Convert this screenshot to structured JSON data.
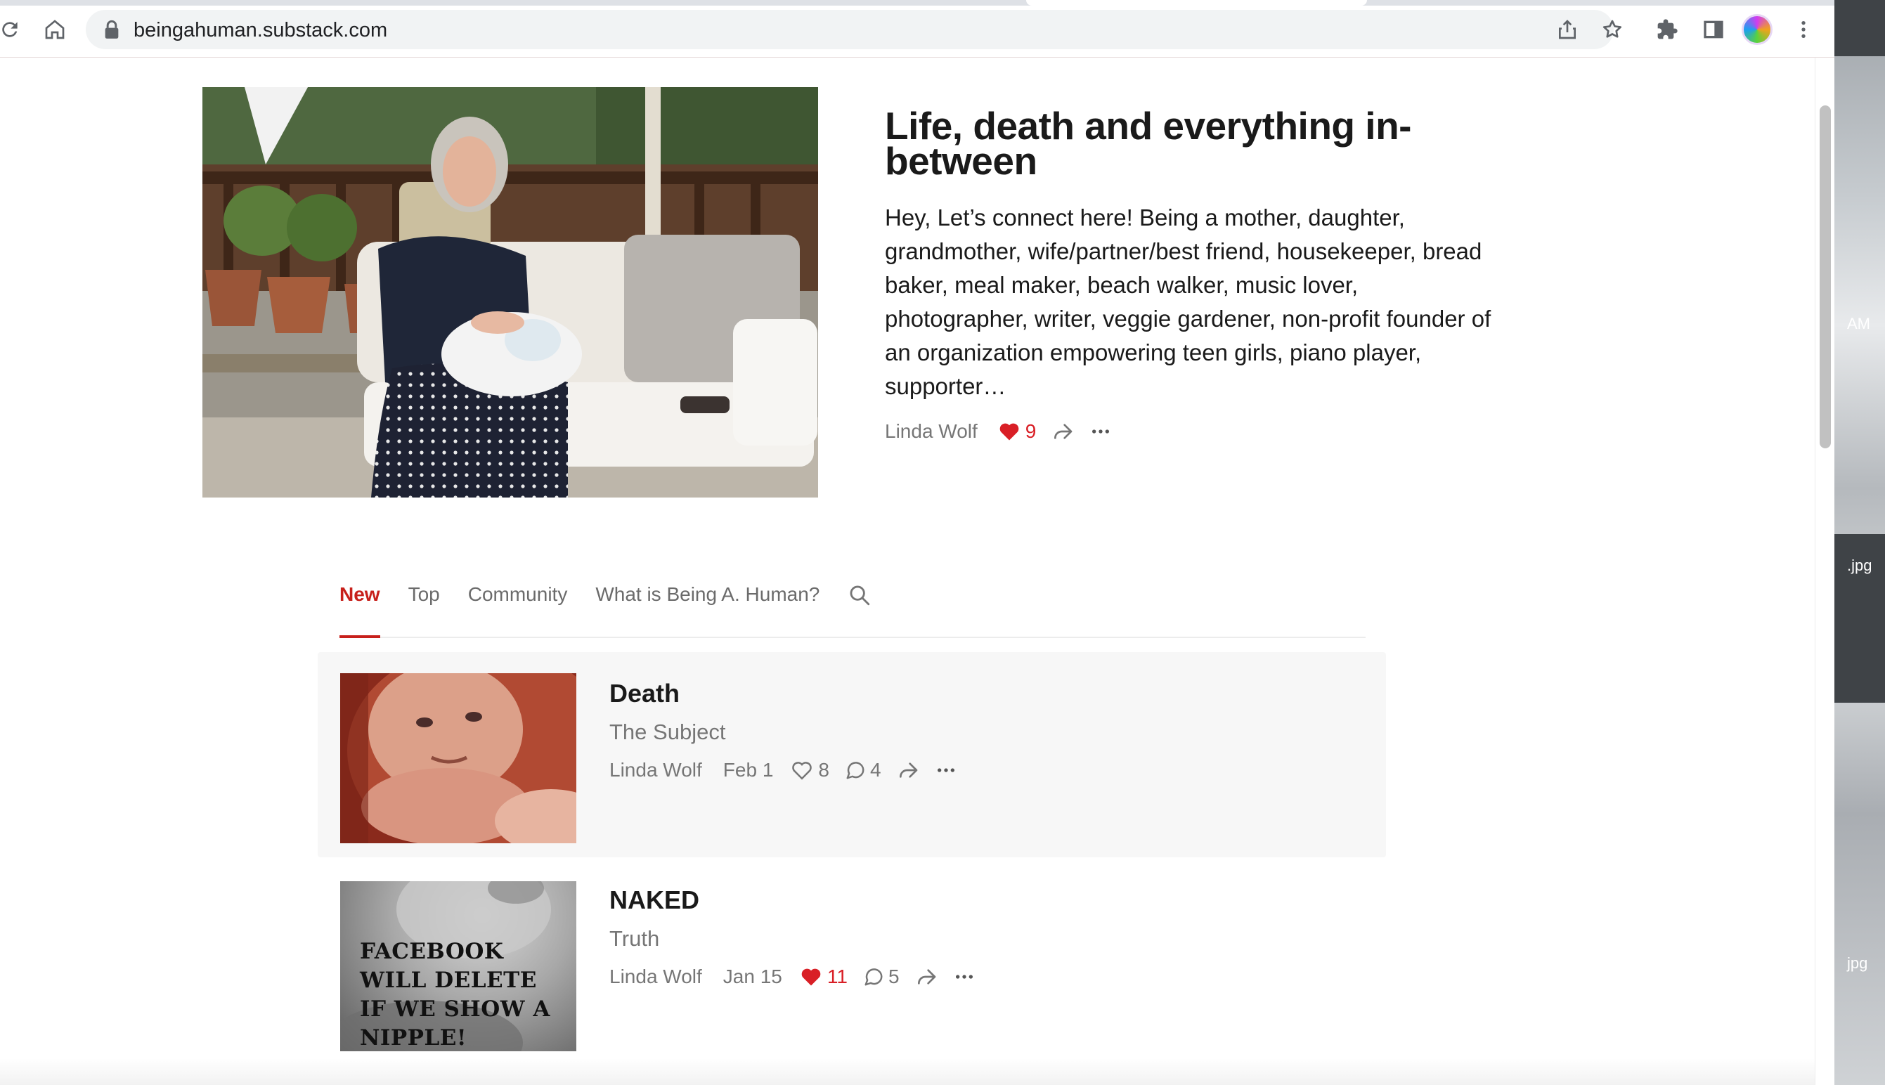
{
  "browser": {
    "url": "beingahuman.substack.com",
    "icons": [
      "reload-icon",
      "home-icon",
      "lock-icon",
      "share-icon",
      "star-icon",
      "extensions-icon",
      "side-panel-icon",
      "profile-avatar",
      "kebab-menu-icon"
    ]
  },
  "desktop": {
    "labels": [
      "AM",
      ".jpg",
      "jpg"
    ]
  },
  "hero": {
    "title": "Life, death and everything in-between",
    "subtitle": "Hey, Let’s connect here! Being a mother, daughter, grandmother, wife/partner/best friend, housekeeper, bread baker, meal maker, beach walker, music lover, photographer, writer, veggie gardener, non-profit founder of an organization empowering teen girls, piano player, supporter…",
    "author": "Linda Wolf",
    "likes": "9"
  },
  "tabs": [
    {
      "label": "New",
      "active": true
    },
    {
      "label": "Top"
    },
    {
      "label": "Community"
    },
    {
      "label": "What is Being A. Human?"
    }
  ],
  "posts": [
    {
      "title": "Death",
      "subtitle": "The Subject",
      "author": "Linda Wolf",
      "date": "Feb 1",
      "likes": "8",
      "comments": "4",
      "liked": false
    },
    {
      "title": "NAKED",
      "subtitle": "Truth",
      "author": "Linda Wolf",
      "date": "Jan 15",
      "likes": "11",
      "comments": "5",
      "liked": true,
      "thumbnail_text": "FACEBOOK WILL DELETE IF WE SHOW A NIPPLE!"
    }
  ],
  "colors": {
    "accent": "#c7201b",
    "like_red": "#d91f26",
    "meta_gray": "#767676",
    "highlight_bg": "#f7f7f7"
  }
}
